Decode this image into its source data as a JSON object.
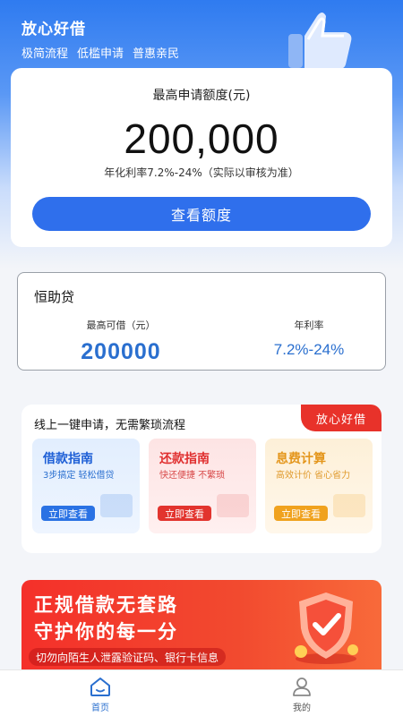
{
  "header": {
    "app_title": "放心好借",
    "taglines": [
      "极简流程",
      "低槛申请",
      "普惠亲民"
    ]
  },
  "quota_card": {
    "label": "最高申请额度(元)",
    "amount": "200,000",
    "rate_note": "年化利率7.2%-24%（实际以审核为准）",
    "button": "查看额度"
  },
  "product_card": {
    "name": "恒助贷",
    "max_label": "最高可借（元）",
    "max_value": "200000",
    "rate_label": "年利率",
    "rate_value": "7.2%-24%"
  },
  "guides": {
    "title": "线上一键申请，无需繁琐流程",
    "badge": "放心好借",
    "tiles": [
      {
        "title": "借款指南",
        "subtitle": "3步搞定 轻松借贷",
        "button": "立即查看"
      },
      {
        "title": "还款指南",
        "subtitle": "快还便捷 不繁琐",
        "button": "立即查看"
      },
      {
        "title": "息费计算",
        "subtitle": "高效计价 省心省力",
        "button": "立即查看"
      }
    ]
  },
  "banner": {
    "line1": "正规借款无套路",
    "line2": "守护你的每一分",
    "warning": "切勿向陌生人泄露验证码、银行卡信息"
  },
  "tabbar": {
    "home": "首页",
    "mine": "我的"
  },
  "colors": {
    "primary": "#2f6fec",
    "accent_red": "#e8322a",
    "value_blue": "#2a6fcf"
  },
  "icons": {
    "thumb": "thumbs-up-icon",
    "shield": "shield-check-icon",
    "home": "home-icon",
    "user": "user-icon"
  }
}
